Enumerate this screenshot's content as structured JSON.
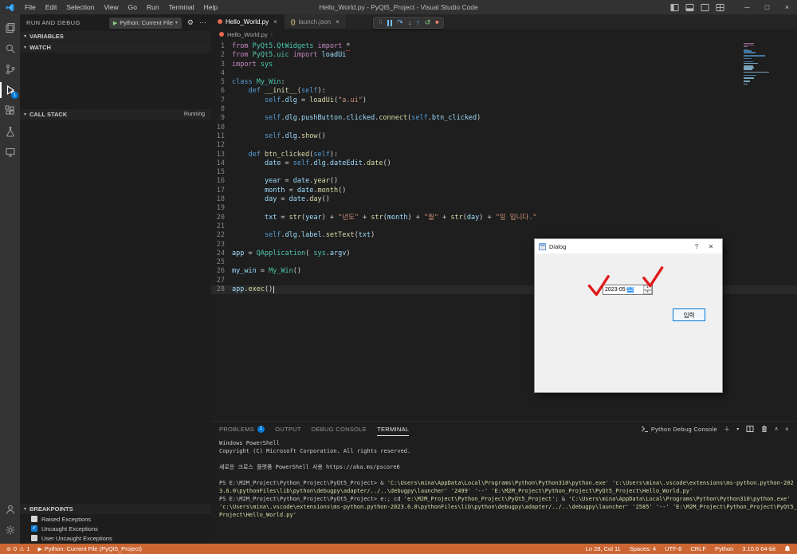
{
  "colors": {
    "status_debug_bg": "#CC6633",
    "badge_blue": "#0078d7",
    "selection_blue": "#3399ff",
    "annotation_red": "#e01b1b",
    "active_tab_bg": "#1e1e1e",
    "restart_green": "#89D185",
    "stop_red": "#F48771",
    "step_blue": "#75BEFF"
  },
  "icons": {
    "chevron_down": "▾",
    "chevron_up": "∧",
    "more": "⋯",
    "gear": "⚙",
    "play": "▶",
    "minimize": "─",
    "maximize": "□",
    "close": "×",
    "step_over": "↷",
    "step_into": "↓",
    "step_out": "↑",
    "restart": "↺",
    "stop": "■",
    "error": "⊘",
    "warning": "⚠",
    "plus": "＋",
    "breadcrumb_chevron": "›",
    "json_braces": "{}"
  },
  "title_bar": {
    "menus": [
      "File",
      "Edit",
      "Selection",
      "View",
      "Go",
      "Run",
      "Terminal",
      "Help"
    ],
    "title": "Hello_World.py - PyQt5_Project - Visual Studio Code"
  },
  "activity_bar": {
    "items": [
      "explorer",
      "search",
      "source-control",
      "run-and-debug",
      "extensions",
      "testing",
      "remote-explorer"
    ],
    "debug_badge": "1"
  },
  "sidebar": {
    "title": "RUN AND DEBUG",
    "config_label": "Python: Current File",
    "sections": {
      "variables": "VARIABLES",
      "watch": "WATCH",
      "call_stack": "CALL STACK",
      "call_stack_status": "Running",
      "breakpoints": "BREAKPOINTS"
    },
    "breakpoints": [
      {
        "label": "Raised Exceptions",
        "checked": false
      },
      {
        "label": "Uncaught Exceptions",
        "checked": true
      },
      {
        "label": "User Uncaught Exceptions",
        "checked": false
      }
    ]
  },
  "tabs": [
    {
      "label": "Hello_World.py",
      "active": true
    },
    {
      "label": "launch.json",
      "active": false
    }
  ],
  "breadcrumb": {
    "file": "Hello_World.py"
  },
  "editor": {
    "current_line": 28,
    "lines": [
      {
        "n": 1,
        "t": [
          [
            "kw",
            "from "
          ],
          [
            "cls",
            "PyQt5.QtWidgets "
          ],
          [
            "kw",
            "import "
          ],
          [
            "er",
            "*"
          ]
        ]
      },
      {
        "n": 2,
        "t": [
          [
            "kw",
            "from "
          ],
          [
            "cls",
            "PyQt5.uic "
          ],
          [
            "kw",
            "import "
          ],
          [
            "vr",
            "loadUi"
          ]
        ]
      },
      {
        "n": 3,
        "t": [
          [
            "kw",
            "import "
          ],
          [
            "cls",
            "sys"
          ]
        ]
      },
      {
        "n": 4,
        "t": []
      },
      {
        "n": 5,
        "t": [
          [
            "kw2",
            "class "
          ],
          [
            "cls",
            "My_Win"
          ],
          [
            "pl",
            ":"
          ]
        ]
      },
      {
        "n": 6,
        "t": [
          [
            "pl",
            "    "
          ],
          [
            "kw2",
            "def "
          ],
          [
            "fn",
            "__init__"
          ],
          [
            "pl",
            "("
          ],
          [
            "kw2",
            "self"
          ],
          [
            "pl",
            "):"
          ]
        ]
      },
      {
        "n": 7,
        "t": [
          [
            "pl",
            "        "
          ],
          [
            "kw2",
            "self"
          ],
          [
            "pl",
            "."
          ],
          [
            "vr",
            "dlg"
          ],
          [
            "pl",
            " = "
          ],
          [
            "fn",
            "loadUi"
          ],
          [
            "pl",
            "("
          ],
          [
            "st",
            "\"a.ui\""
          ],
          [
            "pl",
            ")"
          ]
        ]
      },
      {
        "n": 8,
        "t": []
      },
      {
        "n": 9,
        "t": [
          [
            "pl",
            "        "
          ],
          [
            "kw2",
            "self"
          ],
          [
            "pl",
            "."
          ],
          [
            "vr",
            "dlg"
          ],
          [
            "pl",
            "."
          ],
          [
            "vr",
            "pushButton"
          ],
          [
            "pl",
            "."
          ],
          [
            "vr",
            "clicked"
          ],
          [
            "pl",
            "."
          ],
          [
            "fn",
            "connect"
          ],
          [
            "pl",
            "("
          ],
          [
            "kw2",
            "self"
          ],
          [
            "pl",
            "."
          ],
          [
            "vr",
            "btn_clicked"
          ],
          [
            "pl",
            ")"
          ]
        ]
      },
      {
        "n": 10,
        "t": []
      },
      {
        "n": 11,
        "t": [
          [
            "pl",
            "        "
          ],
          [
            "kw2",
            "self"
          ],
          [
            "pl",
            "."
          ],
          [
            "vr",
            "dlg"
          ],
          [
            "pl",
            "."
          ],
          [
            "fn",
            "show"
          ],
          [
            "pl",
            "()"
          ]
        ]
      },
      {
        "n": 12,
        "t": []
      },
      {
        "n": 13,
        "t": [
          [
            "pl",
            "    "
          ],
          [
            "kw2",
            "def "
          ],
          [
            "fn",
            "btn_clicked"
          ],
          [
            "pl",
            "("
          ],
          [
            "kw2",
            "self"
          ],
          [
            "pl",
            "):"
          ]
        ]
      },
      {
        "n": 14,
        "t": [
          [
            "pl",
            "        "
          ],
          [
            "vr",
            "date"
          ],
          [
            "pl",
            " = "
          ],
          [
            "kw2",
            "self"
          ],
          [
            "pl",
            "."
          ],
          [
            "vr",
            "dlg"
          ],
          [
            "pl",
            "."
          ],
          [
            "vr",
            "dateEdit"
          ],
          [
            "pl",
            "."
          ],
          [
            "fn",
            "date"
          ],
          [
            "pl",
            "()"
          ]
        ]
      },
      {
        "n": 15,
        "t": []
      },
      {
        "n": 16,
        "t": [
          [
            "pl",
            "        "
          ],
          [
            "vr",
            "year"
          ],
          [
            "pl",
            " = "
          ],
          [
            "vr",
            "date"
          ],
          [
            "pl",
            "."
          ],
          [
            "fn",
            "year"
          ],
          [
            "pl",
            "()"
          ]
        ]
      },
      {
        "n": 17,
        "t": [
          [
            "pl",
            "        "
          ],
          [
            "vr",
            "month"
          ],
          [
            "pl",
            " = "
          ],
          [
            "vr",
            "date"
          ],
          [
            "pl",
            "."
          ],
          [
            "fn",
            "month"
          ],
          [
            "pl",
            "()"
          ]
        ]
      },
      {
        "n": 18,
        "t": [
          [
            "pl",
            "        "
          ],
          [
            "vr",
            "day"
          ],
          [
            "pl",
            " = "
          ],
          [
            "vr",
            "date"
          ],
          [
            "pl",
            "."
          ],
          [
            "fn",
            "day"
          ],
          [
            "pl",
            "()"
          ]
        ]
      },
      {
        "n": 19,
        "t": []
      },
      {
        "n": 20,
        "t": [
          [
            "pl",
            "        "
          ],
          [
            "vr",
            "txt"
          ],
          [
            "pl",
            " = "
          ],
          [
            "fn",
            "str"
          ],
          [
            "pl",
            "("
          ],
          [
            "vr",
            "year"
          ],
          [
            "pl",
            ") + "
          ],
          [
            "st",
            "\"년도\""
          ],
          [
            "pl",
            " + "
          ],
          [
            "fn",
            "str"
          ],
          [
            "pl",
            "("
          ],
          [
            "vr",
            "month"
          ],
          [
            "pl",
            ") + "
          ],
          [
            "st",
            "\"월\""
          ],
          [
            "pl",
            " + "
          ],
          [
            "fn",
            "str"
          ],
          [
            "pl",
            "("
          ],
          [
            "vr",
            "day"
          ],
          [
            "pl",
            ") + "
          ],
          [
            "st",
            "\"일 입니다.\""
          ]
        ]
      },
      {
        "n": 21,
        "t": []
      },
      {
        "n": 22,
        "t": [
          [
            "pl",
            "        "
          ],
          [
            "kw2",
            "self"
          ],
          [
            "pl",
            "."
          ],
          [
            "vr",
            "dlg"
          ],
          [
            "pl",
            "."
          ],
          [
            "vr",
            "label"
          ],
          [
            "pl",
            "."
          ],
          [
            "fn",
            "setText"
          ],
          [
            "pl",
            "("
          ],
          [
            "vr",
            "txt"
          ],
          [
            "pl",
            ")"
          ]
        ]
      },
      {
        "n": 23,
        "t": []
      },
      {
        "n": 24,
        "t": [
          [
            "vr",
            "app"
          ],
          [
            "pl",
            " = "
          ],
          [
            "cls",
            "QApplication"
          ],
          [
            "pl",
            "( "
          ],
          [
            "cls",
            "sys"
          ],
          [
            "pl",
            "."
          ],
          [
            "vr",
            "argv"
          ],
          [
            "pl",
            ")"
          ]
        ]
      },
      {
        "n": 25,
        "t": []
      },
      {
        "n": 26,
        "t": [
          [
            "vr",
            "my_win"
          ],
          [
            "pl",
            " = "
          ],
          [
            "cls",
            "My_Win"
          ],
          [
            "pl",
            "()"
          ]
        ]
      },
      {
        "n": 27,
        "t": []
      },
      {
        "n": 28,
        "t": [
          [
            "vr",
            "app"
          ],
          [
            "pl",
            "."
          ],
          [
            "fn",
            "exec"
          ],
          [
            "pl",
            "()"
          ]
        ]
      }
    ]
  },
  "panel": {
    "tabs": [
      {
        "label": "PROBLEMS",
        "badge": "1",
        "active": false
      },
      {
        "label": "OUTPUT",
        "active": false
      },
      {
        "label": "DEBUG CONSOLE",
        "active": false
      },
      {
        "label": "TERMINAL",
        "active": true
      }
    ],
    "profile_label": "Python Debug Console",
    "terminal_lines": [
      [
        [
          "tw",
          "Windows PowerShell"
        ]
      ],
      [
        [
          "tw",
          "Copyright (C) Microsoft Corporation. All rights reserved."
        ]
      ],
      [],
      [
        [
          "tw",
          "새로운 크로스 플랫폼 PowerShell 사용 https://aka.ms/pscore6"
        ]
      ],
      [],
      [
        [
          "tw",
          "PS E:\\M2M_Project\\Python_Project\\PyQt5_Project> & "
        ],
        [
          "ty",
          "'C:\\Users\\mina\\AppData\\Local\\Programs\\Python\\Python310\\python.exe'"
        ],
        [
          "tw",
          " "
        ],
        [
          "ty",
          "'c:\\Users\\mina\\.vscode\\extensions\\ms-python.python-202"
        ]
      ],
      [
        [
          "ty",
          "3.6.0\\pythonFiles\\lib\\python\\debugpy\\adapter/../..\\debugpy\\launcher' '2499' '--' 'E:\\M2M_Project\\Python_Project\\PyQt5_Project\\Hello_World.py'"
        ]
      ],
      [
        [
          "tw",
          "PS E:\\M2M_Project\\Python_Project\\PyQt5_Project> e:; cd "
        ],
        [
          "ty",
          "'e:\\M2M_Project\\Python_Project\\PyQt5_Project'"
        ],
        [
          "tw",
          "; & "
        ],
        [
          "ty",
          "'C:\\Users\\mina\\AppData\\Local\\Programs\\Python\\Python310\\python.exe'"
        ]
      ],
      [
        [
          "ty",
          "'c:\\Users\\mina\\.vscode\\extensions\\ms-python.python-2023.6.0\\pythonFiles\\lib\\python\\debugpy\\adapter/../..\\debugpy\\launcher' '2585' '--' 'E:\\M2M_Project\\Python_Project\\PyQt5_"
        ]
      ],
      [
        [
          "ty",
          "Project\\Hello_World.py'"
        ]
      ]
    ]
  },
  "status_bar": {
    "errors": "0",
    "warnings": "1",
    "debug_label": "Python: Current File (PyQt5_Project)",
    "right_items": [
      {
        "name": "cursor-position",
        "label": "Ln 28, Col 11"
      },
      {
        "name": "indentation",
        "label": "Spaces: 4"
      },
      {
        "name": "encoding",
        "label": "UTF-8"
      },
      {
        "name": "eol-sequence",
        "label": "CRLF"
      },
      {
        "name": "language-mode",
        "label": "Python"
      },
      {
        "name": "python-interpreter",
        "label": "3.10.6 64-bit"
      }
    ]
  },
  "dialog": {
    "title": "Dialog",
    "help_label": "?",
    "close_label": "✕",
    "date_prefix": "2023-05-",
    "date_selected": "12",
    "button_label": "입력"
  }
}
